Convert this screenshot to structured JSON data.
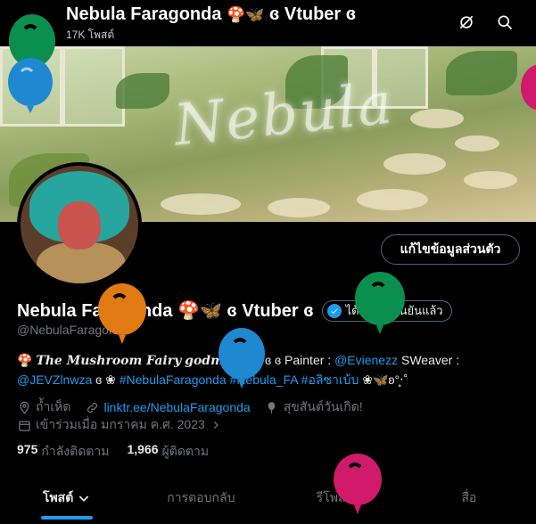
{
  "header": {
    "back_icon": "arrow-left-icon",
    "title": "Nebula Faragonda",
    "title_emoji": "🍄🦋",
    "title_suffix": "ɞ Vtuber ɞ",
    "post_count": "17K โพสต์",
    "icons": [
      "search-off-icon",
      "search-icon"
    ]
  },
  "profile": {
    "edit_button": "แก้ไขข้อมูลส่วนตัว",
    "name": "Nebula Faragonda",
    "name_emoji": "🍄🦋",
    "name_suffix": "ɞ Vtuber ɞ",
    "verified_label": "ได้รับการยืนยันแล้ว",
    "handle": "@NebulaFaragonda",
    "bio": {
      "line1_emoji": "🍄",
      "line1_fancy": "The Mushroom Fairy",
      "line1_godmother": "godmother",
      "line1_mid": "ɞ ɞ Painter :",
      "line1_link": "@Evienezz",
      "line1_tail": "SWeaver :",
      "line2_link1": "@JEVZlnwza",
      "line2_mid": "ɞ ❀",
      "line2_tags": "#NebulaFaragonda #Nebula_FA #อลิซาเบ้บ",
      "line2_tail": "❀🦋ʚ°̥‧˚"
    },
    "location": "ถ้ำเห็ด",
    "website": "linktr.ee/NebulaFaragonda",
    "birthday": "สุขสันต์วันเกิด!",
    "joined": "เข้าร่วมเมื่อ มกราคม ค.ศ. 2023",
    "following_count": "975",
    "following_label": "กำลังติดตาม",
    "followers_count": "1,966",
    "followers_label": "ผู้ติดตาม"
  },
  "tabs": [
    {
      "label": "โพสต์",
      "active": true
    },
    {
      "label": "การตอบกลับ",
      "active": false
    },
    {
      "label": "รีโพสต์",
      "active": false
    },
    {
      "label": "สื่อ",
      "active": false
    }
  ],
  "colors": {
    "accent": "#1d9bf0",
    "balloon_green": "#0a8f4e",
    "balloon_blue": "#1e88d0",
    "balloon_orange": "#e07a12",
    "balloon_pink": "#d01a6a"
  }
}
